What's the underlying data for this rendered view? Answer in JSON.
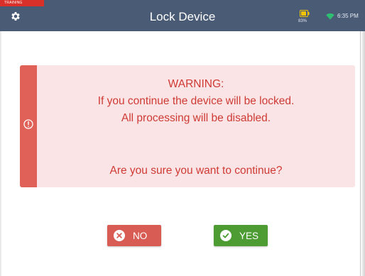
{
  "header": {
    "training_label": "TRAINING",
    "title": "Lock Device",
    "battery_percent": "83%",
    "time": "6:35 PM",
    "icons": [
      "gear-icon",
      "battery-icon",
      "wifi-icon"
    ]
  },
  "alert": {
    "line1": "WARNING:",
    "line2": "If you continue the device will be locked.",
    "line3": "All processing will be disabled.",
    "question": "Are you sure you want to continue?",
    "icon": "exclamation-circle-icon"
  },
  "buttons": {
    "no_label": "NO",
    "yes_label": "YES",
    "no_icon": "x-circle-icon",
    "yes_icon": "check-circle-icon"
  },
  "colors": {
    "topbar": "#4a5b76",
    "training_badge": "#d9302a",
    "alert_background": "#fbe4e5",
    "alert_stripe": "#df6158",
    "alert_text": "#cf3a34",
    "no_button": "#d85c54",
    "yes_button": "#4d9c33",
    "wifi": "#2fbf71",
    "battery": "#f2c200"
  }
}
